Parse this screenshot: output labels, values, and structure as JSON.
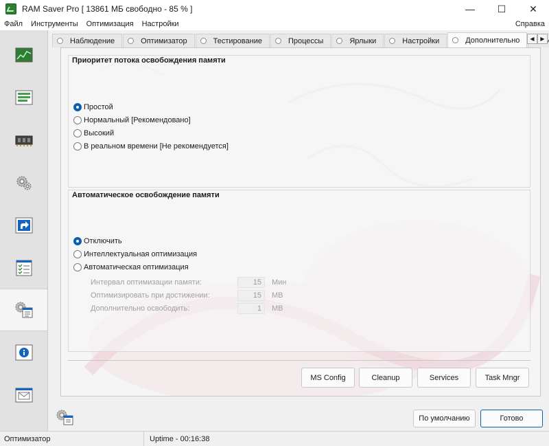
{
  "window": {
    "title": "RAM Saver Pro [ 13861 МБ свободно - 85 % ]",
    "minimize": "—",
    "maximize": "☐",
    "close": "✕"
  },
  "menu": {
    "items": [
      "Файл",
      "Инструменты",
      "Оптимизация",
      "Настройки"
    ],
    "help": "Справка"
  },
  "sidebar": {
    "items": [
      {
        "icon": "monitor-graph-icon"
      },
      {
        "icon": "memory-bars-icon"
      },
      {
        "icon": "ram-chip-icon"
      },
      {
        "icon": "gears-icon"
      },
      {
        "icon": "shortcut-arrow-icon"
      },
      {
        "icon": "checklist-icon"
      },
      {
        "icon": "settings-window-icon",
        "active": true
      },
      {
        "icon": "info-icon"
      },
      {
        "icon": "envelope-icon"
      }
    ]
  },
  "tabs": [
    "Наблюдение",
    "Оптимизатор",
    "Тестирование",
    "Процессы",
    "Ярлыки",
    "Настройки",
    "Дополнительно",
    "И"
  ],
  "active_tab": "Дополнительно",
  "priority_group": {
    "legend": "Приоритет потока освобождения памяти",
    "options": [
      "Простой",
      "Нормальный [Рекомендовано]",
      "Высокий",
      "В реальном времени [Не рекомендуется]"
    ],
    "selected": 0
  },
  "auto_group": {
    "legend": "Автоматическое освобождение памяти",
    "options": [
      "Отключить",
      "Интеллектуальная оптимизация",
      "Автоматическая оптимизация"
    ],
    "selected": 0,
    "params": [
      {
        "label": "Интервал оптимизации памяти:",
        "value": "15",
        "unit": "Мин"
      },
      {
        "label": "Оптимизировать при достижении:",
        "value": "15",
        "unit": "MB"
      },
      {
        "label": "Дополнительно освободить:",
        "value": "1",
        "unit": "MB"
      }
    ]
  },
  "tool_buttons": [
    "MS Config",
    "Cleanup",
    "Services",
    "Task Mngr"
  ],
  "footer": {
    "default_button": "По умолчанию",
    "done_button": "Готово"
  },
  "status": {
    "left": "Оптимизатор",
    "uptime": "Uptime - 00:16:38"
  }
}
